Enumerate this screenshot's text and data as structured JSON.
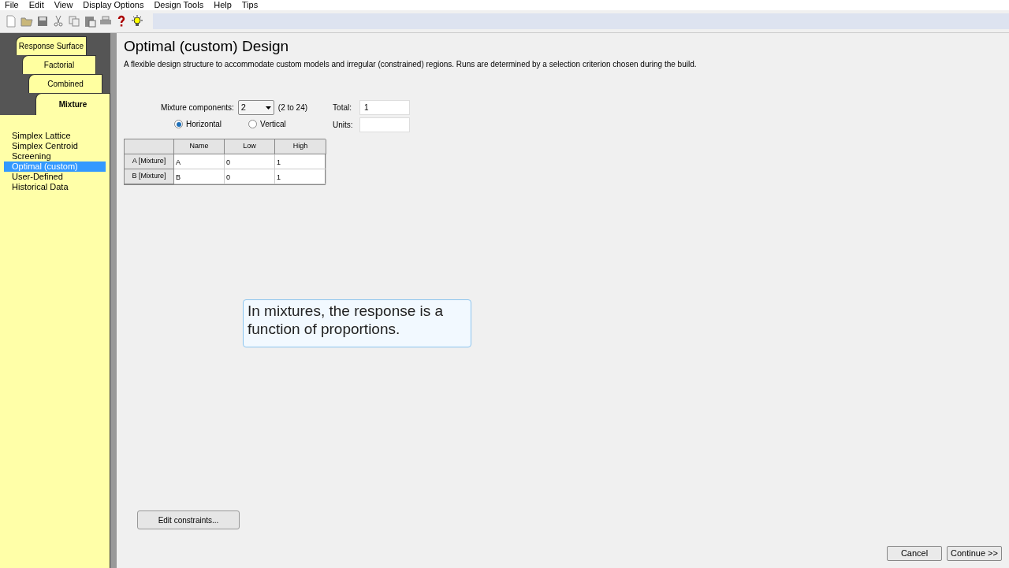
{
  "menu": [
    "File",
    "Edit",
    "View",
    "Display Options",
    "Design Tools",
    "Help",
    "Tips"
  ],
  "toolbar": [
    {
      "kind": "new"
    },
    {
      "kind": "open"
    },
    {
      "kind": "save"
    },
    {
      "kind": "cut"
    },
    {
      "kind": "copy"
    },
    {
      "kind": "paste"
    },
    {
      "kind": "print"
    },
    {
      "kind": "help"
    },
    {
      "kind": "tip"
    }
  ],
  "tabs": [
    {
      "label": "Response Surface",
      "selected": false
    },
    {
      "label": "Factorial",
      "selected": false
    },
    {
      "label": "Combined",
      "selected": false
    },
    {
      "label": "Mixture",
      "selected": true
    }
  ],
  "designs": [
    {
      "label": "Simplex Lattice",
      "selected": false
    },
    {
      "label": "Simplex Centroid",
      "selected": false
    },
    {
      "label": "Screening",
      "selected": false
    },
    {
      "label": "Optimal (custom)",
      "selected": true
    },
    {
      "label": "User-Defined",
      "selected": false
    },
    {
      "label": "Historical Data",
      "selected": false
    }
  ],
  "title": "Optimal (custom) Design",
  "description": "A flexible design structure to accommodate custom models and irregular (constrained) regions.  Runs are determined by a selection criterion chosen during the build.",
  "components": {
    "label": "Mixture components:",
    "value": "2",
    "range": "(2 to 24)"
  },
  "total": {
    "label": "Total:",
    "value": "1"
  },
  "units": {
    "label": "Units:"
  },
  "orientation": [
    {
      "label": "Horizontal",
      "selected": true
    },
    {
      "label": "Vertical",
      "selected": false
    }
  ],
  "table": {
    "columns": [
      "Name",
      "Low",
      "High"
    ],
    "rows": [
      {
        "header": "A [Mixture]",
        "cells": [
          "A",
          "0",
          "1"
        ]
      },
      {
        "header": "B [Mixture]",
        "cells": [
          "B",
          "0",
          "1"
        ]
      }
    ]
  },
  "callout": "In mixtures, the response is a function of proportions.",
  "edit_button": "Edit constraints...",
  "buttons": [
    "Cancel",
    "Continue >>"
  ]
}
